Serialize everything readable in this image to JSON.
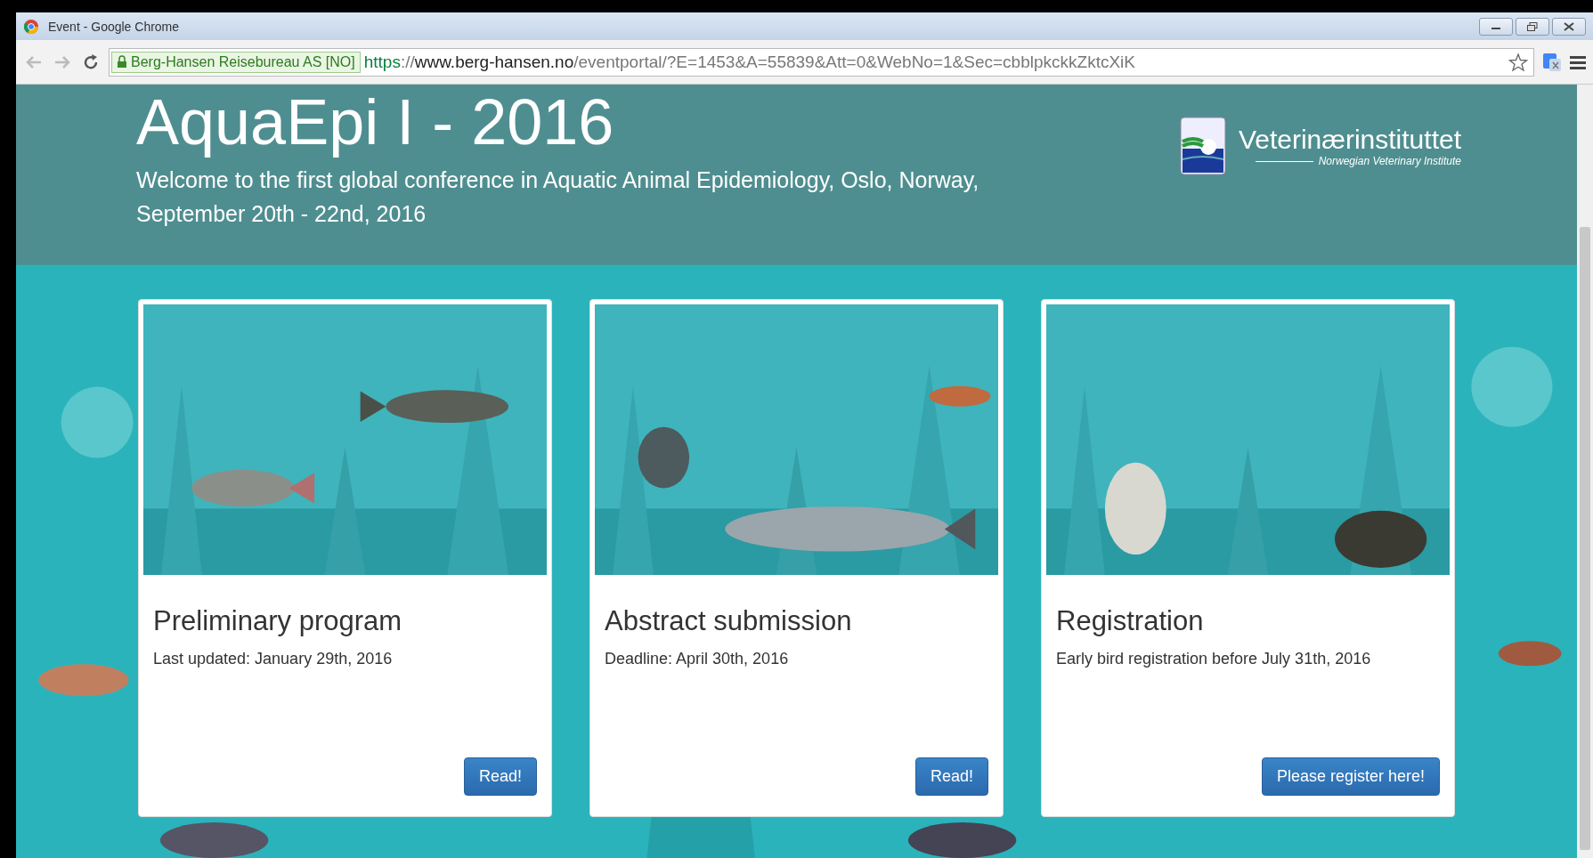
{
  "window": {
    "title": "Event - Google Chrome"
  },
  "address_bar": {
    "identity": "Berg-Hansen Reisebureau AS [NO]",
    "url_parts": [
      {
        "kind": "scheme",
        "text": "https"
      },
      {
        "kind": "sep",
        "text": "://"
      },
      {
        "kind": "host",
        "text": "www.berg-hansen.no"
      },
      {
        "kind": "path",
        "text": "/eventportal/?E=1453&A=55839&Att=0&WebNo=1&Sec=cbblpkckkZktcXiK"
      }
    ]
  },
  "header": {
    "title": "AquaEpi I - 2016",
    "subtitle": "Welcome to the first global conference in Aquatic Animal Epidemiology, Oslo, Norway, September 20th - 22nd, 2016",
    "logo": {
      "name": "Veterinærinstituttet",
      "tagline": "Norwegian Veterinary Institute"
    }
  },
  "cards": [
    {
      "title": "Preliminary program",
      "text": "Last updated: January 29th, 2016",
      "button": "Read!"
    },
    {
      "title": "Abstract submission",
      "text": "Deadline: April 30th, 2016",
      "button": "Read!"
    },
    {
      "title": "Registration",
      "text": "Early bird registration before July 31th, 2016",
      "button": "Please register here!"
    }
  ]
}
